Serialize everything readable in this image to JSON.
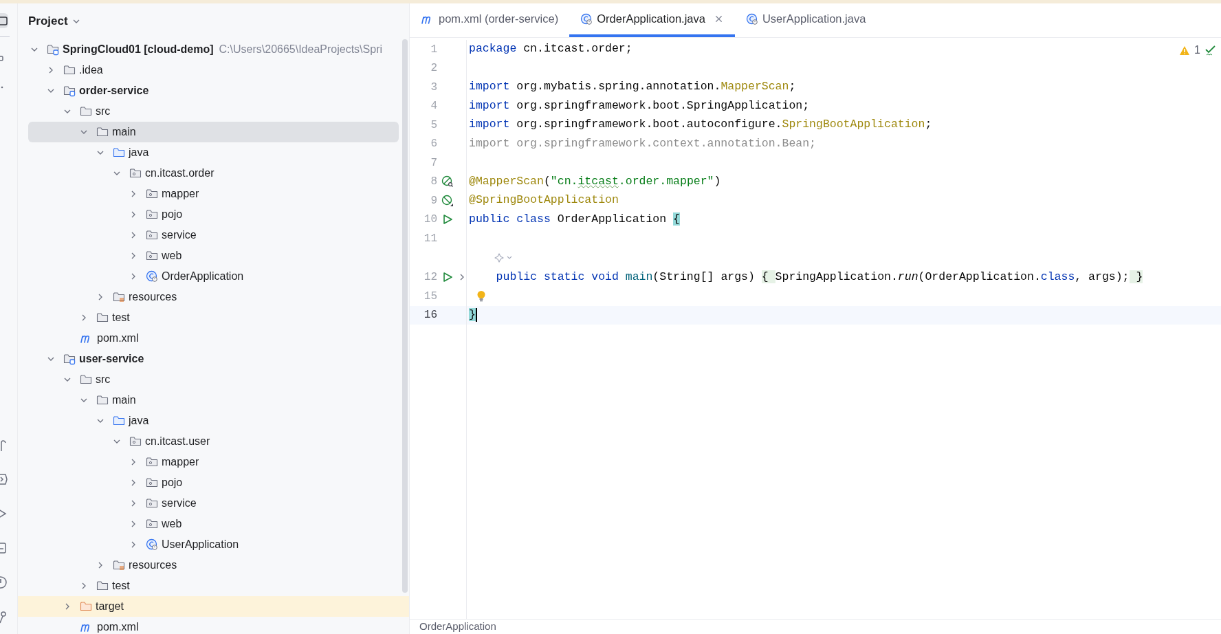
{
  "panel": {
    "title": "Project"
  },
  "project_tree": [
    {
      "label": "SpringCloud01 **[cloud-demo]**",
      "path": "C:\\Users\\20665\\IdeaProjects\\Spri",
      "kind": "module",
      "expanded": true,
      "selected": false,
      "children": [
        {
          "label": ".idea",
          "kind": "folder",
          "expanded": false,
          "selected": false
        },
        {
          "label": "order-service",
          "kind": "module",
          "expanded": true,
          "selected": false,
          "children": [
            {
              "label": "src",
              "kind": "folder",
              "expanded": true,
              "selected": false,
              "children": [
                {
                  "label": "main",
                  "kind": "folder",
                  "expanded": true,
                  "selected": true,
                  "children": [
                    {
                      "label": "java",
                      "kind": "source-root",
                      "expanded": true,
                      "selected": false,
                      "children": [
                        {
                          "label": "cn.itcast.order",
                          "kind": "package",
                          "expanded": true,
                          "selected": false,
                          "children": [
                            {
                              "label": "mapper",
                              "kind": "package",
                              "expanded": false,
                              "selected": false
                            },
                            {
                              "label": "pojo",
                              "kind": "package",
                              "expanded": false,
                              "selected": false
                            },
                            {
                              "label": "service",
                              "kind": "package",
                              "expanded": false,
                              "selected": false
                            },
                            {
                              "label": "web",
                              "kind": "package",
                              "expanded": false,
                              "selected": false
                            },
                            {
                              "label": "OrderApplication",
                              "kind": "class",
                              "expanded": false,
                              "selected": false
                            }
                          ]
                        }
                      ]
                    },
                    {
                      "label": "resources",
                      "kind": "resources",
                      "expanded": false,
                      "selected": false
                    }
                  ]
                },
                {
                  "label": "test",
                  "kind": "folder",
                  "expanded": false,
                  "selected": false
                }
              ]
            },
            {
              "label": "pom.xml",
              "kind": "maven",
              "selected": false
            }
          ]
        },
        {
          "label": "user-service",
          "kind": "module",
          "expanded": true,
          "selected": false,
          "children": [
            {
              "label": "src",
              "kind": "folder",
              "expanded": true,
              "selected": false,
              "children": [
                {
                  "label": "main",
                  "kind": "folder",
                  "expanded": true,
                  "selected": false,
                  "children": [
                    {
                      "label": "java",
                      "kind": "source-root",
                      "expanded": true,
                      "selected": false,
                      "children": [
                        {
                          "label": "cn.itcast.user",
                          "kind": "package",
                          "expanded": true,
                          "selected": false,
                          "children": [
                            {
                              "label": "mapper",
                              "kind": "package",
                              "expanded": false,
                              "selected": false
                            },
                            {
                              "label": "pojo",
                              "kind": "package",
                              "expanded": false,
                              "selected": false
                            },
                            {
                              "label": "service",
                              "kind": "package",
                              "expanded": false,
                              "selected": false
                            },
                            {
                              "label": "web",
                              "kind": "package",
                              "expanded": false,
                              "selected": false
                            },
                            {
                              "label": "UserApplication",
                              "kind": "class",
                              "expanded": false,
                              "selected": false
                            }
                          ]
                        }
                      ]
                    },
                    {
                      "label": "resources",
                      "kind": "resources",
                      "expanded": false,
                      "selected": false
                    }
                  ]
                },
                {
                  "label": "test",
                  "kind": "folder",
                  "expanded": false,
                  "selected": false
                }
              ]
            },
            {
              "label": "target",
              "kind": "excluded",
              "expanded": false,
              "selected": false
            },
            {
              "label": "pom.xml",
              "kind": "maven",
              "selected": false
            }
          ]
        }
      ]
    }
  ],
  "tabs": [
    {
      "label": "pom.xml (order-service)",
      "kind": "maven",
      "selected": false,
      "closable": false
    },
    {
      "label": "OrderApplication.java",
      "kind": "class",
      "selected": true,
      "closable": true
    },
    {
      "label": "UserApplication.java",
      "kind": "class",
      "selected": false,
      "closable": false
    }
  ],
  "inspections": {
    "warnings": "1"
  },
  "code_lines": [
    {
      "number": "1",
      "current": false,
      "segments": [
        {
          "kind": "kw",
          "text": "package "
        },
        {
          "kind": "plain",
          "text": "cn.itcast.order;"
        }
      ]
    },
    {
      "number": "2",
      "current": false
    },
    {
      "number": "3",
      "current": false,
      "segments": [
        {
          "kind": "kw",
          "text": "import "
        },
        {
          "kind": "plain",
          "text": "org.mybatis.spring.annotation."
        },
        {
          "kind": "ann",
          "text": "MapperScan"
        },
        {
          "kind": "plain",
          "text": ";"
        }
      ]
    },
    {
      "number": "4",
      "current": false,
      "segments": [
        {
          "kind": "kw",
          "text": "import "
        },
        {
          "kind": "plain",
          "text": "org.springframework.boot.SpringApplication;"
        }
      ]
    },
    {
      "number": "5",
      "current": false,
      "segments": [
        {
          "kind": "kw",
          "text": "import "
        },
        {
          "kind": "plain",
          "text": "org.springframework.boot.autoconfigure."
        },
        {
          "kind": "ann",
          "text": "SpringBootApplication"
        },
        {
          "kind": "plain",
          "text": ";"
        }
      ]
    },
    {
      "number": "6",
      "current": false,
      "segments": [
        {
          "kind": "muted",
          "text": "import org.springframework.context.annotation.Bean;"
        }
      ]
    },
    {
      "number": "7",
      "current": false
    },
    {
      "number": "8",
      "current": false,
      "kind": "bean-scan",
      "segments": [
        {
          "kind": "ann",
          "text": "@MapperScan"
        },
        {
          "kind": "plain",
          "text": "("
        },
        {
          "kind": "str",
          "text": "\"cn."
        },
        {
          "kind": "str-typo",
          "text": "itcast"
        },
        {
          "kind": "str",
          "text": ".order.mapper\""
        },
        {
          "kind": "plain",
          "text": ")"
        }
      ]
    },
    {
      "number": "9",
      "current": false,
      "kind": "bean-app",
      "segments": [
        {
          "kind": "ann",
          "text": "@SpringBootApplication"
        }
      ]
    },
    {
      "number": "10",
      "current": false,
      "kind": "run",
      "segments": [
        {
          "kind": "kw",
          "text": "public class "
        },
        {
          "kind": "plain",
          "text": "OrderApplication "
        },
        {
          "kind": "match",
          "text": "{"
        }
      ]
    },
    {
      "number": "11",
      "current": false
    },
    {
      "number": "12",
      "current": false,
      "kind": "run",
      "foldable": true,
      "hint_above": true,
      "segments": [
        {
          "kind": "kw",
          "text": "    public static void "
        },
        {
          "kind": "decl",
          "text": "main"
        },
        {
          "kind": "plain",
          "text": "(String[] args) "
        },
        {
          "kind": "fold",
          "text": "{ "
        },
        {
          "kind": "plain",
          "text": "SpringApplication."
        },
        {
          "kind": "italic",
          "text": "run"
        },
        {
          "kind": "plain",
          "text": "(OrderApplication."
        },
        {
          "kind": "kw",
          "text": "class"
        },
        {
          "kind": "plain",
          "text": ", args);"
        },
        {
          "kind": "fold",
          "text": " }"
        }
      ]
    },
    {
      "number": "15",
      "current": false,
      "bulb": true
    },
    {
      "number": "16",
      "current": true,
      "segments": [
        {
          "kind": "match",
          "text": "}"
        }
      ]
    }
  ],
  "breadcrumb": [
    "OrderApplication"
  ]
}
